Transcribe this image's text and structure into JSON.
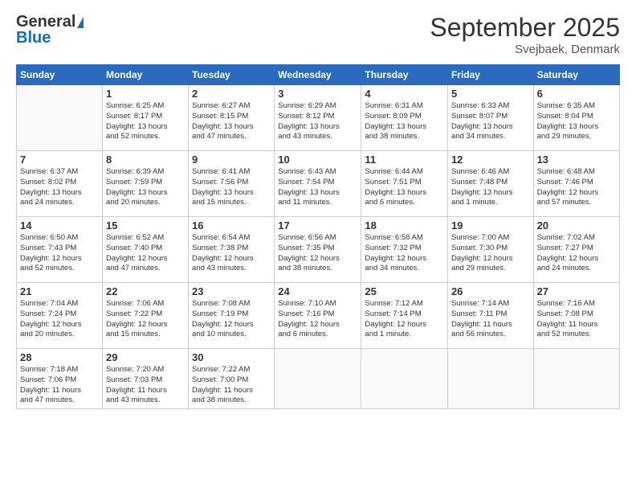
{
  "logo": {
    "line1": "General",
    "line2": "Blue"
  },
  "header": {
    "month": "September 2025",
    "location": "Svejbaek, Denmark"
  },
  "weekdays": [
    "Sunday",
    "Monday",
    "Tuesday",
    "Wednesday",
    "Thursday",
    "Friday",
    "Saturday"
  ],
  "weeks": [
    [
      {
        "day": "",
        "info": ""
      },
      {
        "day": "1",
        "info": "Sunrise: 6:25 AM\nSunset: 8:17 PM\nDaylight: 13 hours\nand 52 minutes."
      },
      {
        "day": "2",
        "info": "Sunrise: 6:27 AM\nSunset: 8:15 PM\nDaylight: 13 hours\nand 47 minutes."
      },
      {
        "day": "3",
        "info": "Sunrise: 6:29 AM\nSunset: 8:12 PM\nDaylight: 13 hours\nand 43 minutes."
      },
      {
        "day": "4",
        "info": "Sunrise: 6:31 AM\nSunset: 8:09 PM\nDaylight: 13 hours\nand 38 minutes."
      },
      {
        "day": "5",
        "info": "Sunrise: 6:33 AM\nSunset: 8:07 PM\nDaylight: 13 hours\nand 34 minutes."
      },
      {
        "day": "6",
        "info": "Sunrise: 6:35 AM\nSunset: 8:04 PM\nDaylight: 13 hours\nand 29 minutes."
      }
    ],
    [
      {
        "day": "7",
        "info": "Sunrise: 6:37 AM\nSunset: 8:02 PM\nDaylight: 13 hours\nand 24 minutes."
      },
      {
        "day": "8",
        "info": "Sunrise: 6:39 AM\nSunset: 7:59 PM\nDaylight: 13 hours\nand 20 minutes."
      },
      {
        "day": "9",
        "info": "Sunrise: 6:41 AM\nSunset: 7:56 PM\nDaylight: 13 hours\nand 15 minutes."
      },
      {
        "day": "10",
        "info": "Sunrise: 6:43 AM\nSunset: 7:54 PM\nDaylight: 13 hours\nand 11 minutes."
      },
      {
        "day": "11",
        "info": "Sunrise: 6:44 AM\nSunset: 7:51 PM\nDaylight: 13 hours\nand 6 minutes."
      },
      {
        "day": "12",
        "info": "Sunrise: 6:46 AM\nSunset: 7:48 PM\nDaylight: 13 hours\nand 1 minute."
      },
      {
        "day": "13",
        "info": "Sunrise: 6:48 AM\nSunset: 7:46 PM\nDaylight: 12 hours\nand 57 minutes."
      }
    ],
    [
      {
        "day": "14",
        "info": "Sunrise: 6:50 AM\nSunset: 7:43 PM\nDaylight: 12 hours\nand 52 minutes."
      },
      {
        "day": "15",
        "info": "Sunrise: 6:52 AM\nSunset: 7:40 PM\nDaylight: 12 hours\nand 47 minutes."
      },
      {
        "day": "16",
        "info": "Sunrise: 6:54 AM\nSunset: 7:38 PM\nDaylight: 12 hours\nand 43 minutes."
      },
      {
        "day": "17",
        "info": "Sunrise: 6:56 AM\nSunset: 7:35 PM\nDaylight: 12 hours\nand 38 minutes."
      },
      {
        "day": "18",
        "info": "Sunrise: 6:58 AM\nSunset: 7:32 PM\nDaylight: 12 hours\nand 34 minutes."
      },
      {
        "day": "19",
        "info": "Sunrise: 7:00 AM\nSunset: 7:30 PM\nDaylight: 12 hours\nand 29 minutes."
      },
      {
        "day": "20",
        "info": "Sunrise: 7:02 AM\nSunset: 7:27 PM\nDaylight: 12 hours\nand 24 minutes."
      }
    ],
    [
      {
        "day": "21",
        "info": "Sunrise: 7:04 AM\nSunset: 7:24 PM\nDaylight: 12 hours\nand 20 minutes."
      },
      {
        "day": "22",
        "info": "Sunrise: 7:06 AM\nSunset: 7:22 PM\nDaylight: 12 hours\nand 15 minutes."
      },
      {
        "day": "23",
        "info": "Sunrise: 7:08 AM\nSunset: 7:19 PM\nDaylight: 12 hours\nand 10 minutes."
      },
      {
        "day": "24",
        "info": "Sunrise: 7:10 AM\nSunset: 7:16 PM\nDaylight: 12 hours\nand 6 minutes."
      },
      {
        "day": "25",
        "info": "Sunrise: 7:12 AM\nSunset: 7:14 PM\nDaylight: 12 hours\nand 1 minute."
      },
      {
        "day": "26",
        "info": "Sunrise: 7:14 AM\nSunset: 7:11 PM\nDaylight: 11 hours\nand 56 minutes."
      },
      {
        "day": "27",
        "info": "Sunrise: 7:16 AM\nSunset: 7:08 PM\nDaylight: 11 hours\nand 52 minutes."
      }
    ],
    [
      {
        "day": "28",
        "info": "Sunrise: 7:18 AM\nSunset: 7:06 PM\nDaylight: 11 hours\nand 47 minutes."
      },
      {
        "day": "29",
        "info": "Sunrise: 7:20 AM\nSunset: 7:03 PM\nDaylight: 11 hours\nand 43 minutes."
      },
      {
        "day": "30",
        "info": "Sunrise: 7:22 AM\nSunset: 7:00 PM\nDaylight: 11 hours\nand 38 minutes."
      },
      {
        "day": "",
        "info": ""
      },
      {
        "day": "",
        "info": ""
      },
      {
        "day": "",
        "info": ""
      },
      {
        "day": "",
        "info": ""
      }
    ]
  ]
}
